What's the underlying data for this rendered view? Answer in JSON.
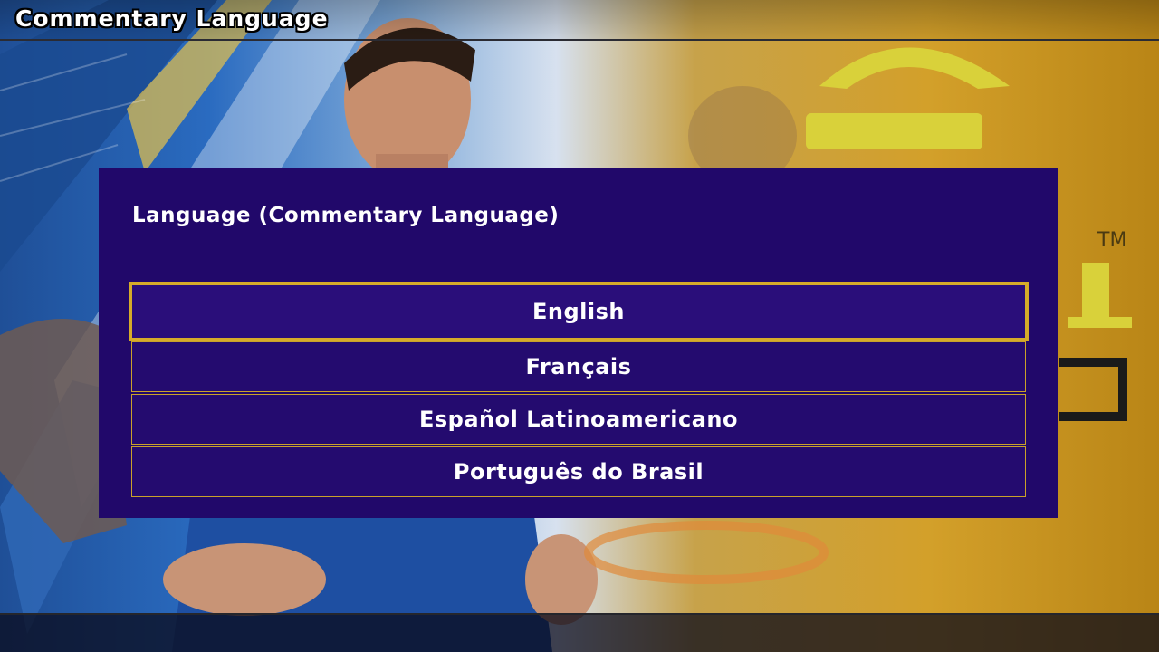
{
  "header": {
    "title": "Commentary Language"
  },
  "dialog": {
    "title": "Language (Commentary Language)",
    "options": [
      {
        "label": "English",
        "selected": true
      },
      {
        "label": "Français",
        "selected": false
      },
      {
        "label": "Español Latinoamericano",
        "selected": false
      },
      {
        "label": "Português do Brasil",
        "selected": false
      }
    ]
  },
  "colors": {
    "dialog_bg": "#21086a",
    "option_border": "#c9a22a",
    "selected_border": "#d6ab2a",
    "text": "#ffffff"
  }
}
